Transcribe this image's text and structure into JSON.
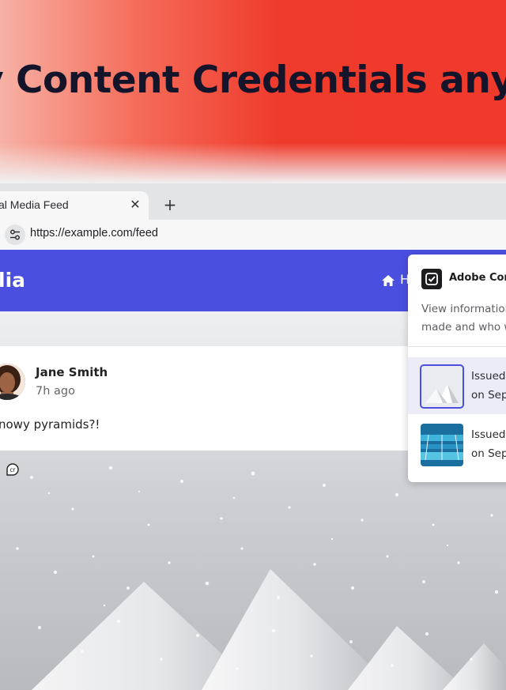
{
  "hero": {
    "title": "v Content Credentials anyw"
  },
  "browser": {
    "tab_title": "al Media Feed",
    "tab_close": "✕",
    "new_tab": "+",
    "url": "https://example.com/feed"
  },
  "app": {
    "brand": "lia",
    "nav_home": "H"
  },
  "post": {
    "author": "Jane Smith",
    "time": "7h ago",
    "text": "nowy pyramids?!"
  },
  "popup": {
    "title": "Adobe Con",
    "desc_line1": "View information",
    "desc_line2": "made and who w",
    "items": [
      {
        "line1": "Issued I",
        "line2": "on Sep"
      },
      {
        "line1": "Issued I",
        "line2": "on Sep"
      }
    ]
  },
  "colors": {
    "accent": "#4a4fe0",
    "hero_red": "#ef3b2c",
    "text_dark": "#14142a"
  },
  "icons": {
    "site_controls": "tune-icon",
    "home": "home-icon",
    "content_credentials": "cr-icon",
    "popup_logo": "checkmark-badge-icon"
  }
}
